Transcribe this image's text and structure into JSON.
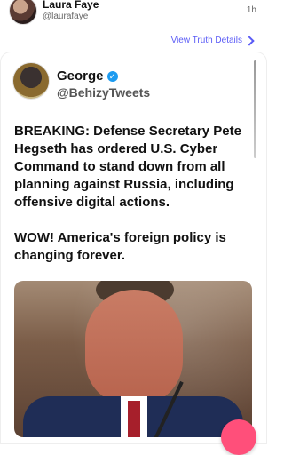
{
  "post": {
    "author": "Laura Faye",
    "handle": "@laurafaye",
    "time": "1h",
    "view_details": "View Truth Details"
  },
  "card": {
    "author": "George",
    "handle": "@BehizyTweets",
    "paragraphs": [
      "BREAKING: Defense Secretary Pete Hegseth has ordered U.S. Cyber Command to stand down from all planning against Russia, including offensive digital actions.",
      "WOW! America's foreign policy is changing forever."
    ]
  },
  "icons": {
    "verified": "verified-check-icon",
    "chevron": "chevron-right-icon"
  },
  "colors": {
    "accent": "#5b5cf6",
    "verified": "#1d9bf0",
    "fab": "#ff4f7a"
  }
}
